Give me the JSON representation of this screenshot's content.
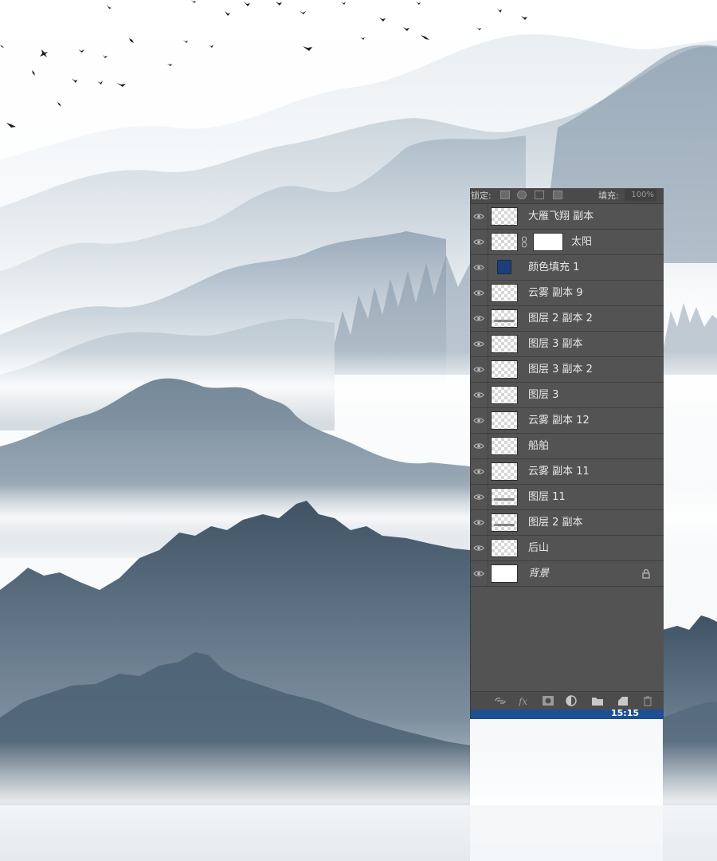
{
  "panel": {
    "lock_label": "锁定:",
    "fill_label": "填充:",
    "fill_value": "100%",
    "time": "15:15"
  },
  "layers": [
    {
      "name": "大雁飞翔 副本",
      "thumb": "transparent"
    },
    {
      "name": "太阳",
      "thumb": "transparent",
      "mask": true
    },
    {
      "name": "颜色填充 1",
      "thumb": "color-fill",
      "color": "#1c3f7a"
    },
    {
      "name": "云雾 副本 9",
      "thumb": "transparent"
    },
    {
      "name": "图层 2 副本 2",
      "thumb": "transparent-ink"
    },
    {
      "name": "图层 3 副本",
      "thumb": "transparent"
    },
    {
      "name": "图层 3 副本 2",
      "thumb": "transparent"
    },
    {
      "name": "图层 3",
      "thumb": "transparent"
    },
    {
      "name": "云雾 副本 12",
      "thumb": "transparent"
    },
    {
      "name": "船舶",
      "thumb": "transparent"
    },
    {
      "name": "云雾 副本 11",
      "thumb": "transparent"
    },
    {
      "name": "图层 11",
      "thumb": "transparent-ink"
    },
    {
      "name": "图层 2 副本",
      "thumb": "transparent-ink"
    },
    {
      "name": "后山",
      "thumb": "transparent"
    },
    {
      "name": "背景",
      "thumb": "white",
      "locked": true
    }
  ],
  "icons": {
    "visibility": "eye-icon",
    "link": "chain-icon",
    "lock": "lock-icon",
    "footer": [
      "link-layers-icon",
      "fx-icon",
      "add-mask-icon",
      "adjustment-layer-icon",
      "new-group-icon",
      "new-layer-icon",
      "trash-icon"
    ]
  },
  "colors": {
    "panel_bg": "#535353",
    "status_bar": "#1d4f91",
    "mountain_dark": "#4a5e70",
    "mountain_mid": "#8d9fae",
    "mist": "#f3f6f8"
  }
}
